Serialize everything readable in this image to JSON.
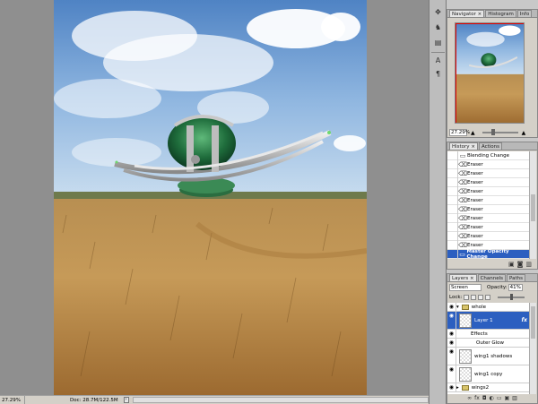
{
  "status": {
    "zoom": "27.29%",
    "doc": "Doc: 28.7M/122.5M",
    "arrow": "›"
  },
  "tools": {
    "icons": [
      "move-icon",
      "puppet-icon",
      "stamp-icon",
      "text-icon",
      "paragraph-icon"
    ],
    "glyphs": [
      "✥",
      "♞",
      "▤",
      "A",
      "¶"
    ]
  },
  "navigator": {
    "tabs": [
      "Navigator ×",
      "Histogram",
      "Info"
    ],
    "zoom": "27.29%",
    "view_color": "#e00000"
  },
  "history": {
    "tabs": [
      "History ×",
      "Actions"
    ],
    "items": [
      {
        "label": "Blending Change",
        "icon": "layer-icon"
      },
      {
        "label": "Eraser",
        "icon": "eraser-icon"
      },
      {
        "label": "Eraser",
        "icon": "eraser-icon"
      },
      {
        "label": "Eraser",
        "icon": "eraser-icon"
      },
      {
        "label": "Eraser",
        "icon": "eraser-icon"
      },
      {
        "label": "Eraser",
        "icon": "eraser-icon"
      },
      {
        "label": "Eraser",
        "icon": "eraser-icon"
      },
      {
        "label": "Eraser",
        "icon": "eraser-icon"
      },
      {
        "label": "Eraser",
        "icon": "eraser-icon"
      },
      {
        "label": "Eraser",
        "icon": "eraser-icon"
      },
      {
        "label": "Eraser",
        "icon": "eraser-icon"
      },
      {
        "label": "Master Opacity Change",
        "icon": "layer-icon",
        "selected": true
      }
    ],
    "selected_color": "#2c5fc0"
  },
  "layers": {
    "tabs": [
      "Layers ×",
      "Channels",
      "Paths"
    ],
    "blend_mode": "Screen",
    "opacity_label": "Opacity:",
    "opacity": "41%",
    "lock_label": "Lock:",
    "rows": [
      {
        "name": "whole",
        "type": "group"
      },
      {
        "name": "Layer 1",
        "type": "layer",
        "selected": true,
        "fx": "fx"
      },
      {
        "name": "Effects",
        "type": "effects"
      },
      {
        "name": "Outer Glow",
        "type": "effect"
      },
      {
        "name": "wing1 shadows",
        "type": "layer"
      },
      {
        "name": "wing1 copy",
        "type": "layer"
      },
      {
        "name": "wings2",
        "type": "group"
      }
    ],
    "selected_color": "#2c5fc0"
  }
}
